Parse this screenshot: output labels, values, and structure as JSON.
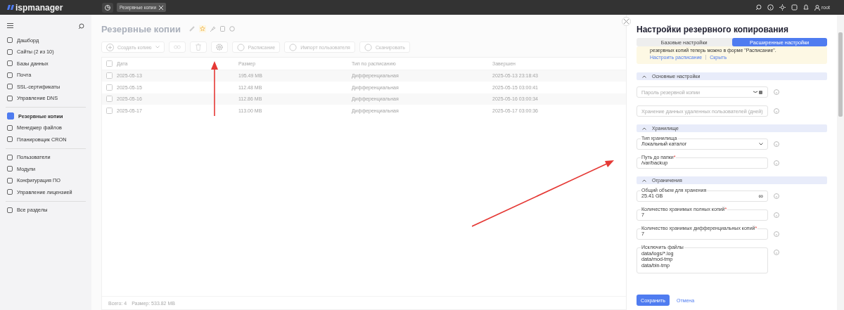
{
  "top_bar": {
    "logo": "ispmanager",
    "tabs": [
      {
        "label": "Резервные копии",
        "selected": true
      }
    ],
    "user": "root"
  },
  "sidebar": {
    "groups": [
      [
        {
          "label": "Дашборд",
          "selected": false
        },
        {
          "label": "Сайты (2 из 10)",
          "selected": false
        },
        {
          "label": "Базы данных",
          "selected": false
        },
        {
          "label": "Почта",
          "selected": false
        },
        {
          "label": "SSL-сертификаты",
          "selected": false
        },
        {
          "label": "Управление DNS",
          "selected": false
        }
      ],
      [
        {
          "label": "Резервные копии",
          "selected": true
        },
        {
          "label": "Менеджер файлов",
          "selected": false
        },
        {
          "label": "Планировщик CRON",
          "selected": false
        }
      ],
      [
        {
          "label": "Пользователи",
          "selected": false
        },
        {
          "label": "Модули",
          "selected": false
        },
        {
          "label": "Конфигурация ПО",
          "selected": false
        },
        {
          "label": "Управление лицензией",
          "selected": false
        }
      ],
      [
        {
          "label": "Все разделы",
          "selected": false
        }
      ]
    ]
  },
  "page": {
    "title": "Резервные копии",
    "toolbar": [
      {
        "kind": "dropdown",
        "label": "Создать копию"
      },
      {
        "kind": "icon"
      },
      {
        "kind": "icon"
      },
      {
        "kind": "icon"
      },
      {
        "kind": "text",
        "label": "Расписание"
      },
      {
        "kind": "text",
        "label": "Импорт пользователя"
      },
      {
        "kind": "text",
        "label": "Сканировать"
      }
    ],
    "table": {
      "all_checked": false,
      "columns": [
        "Дата",
        "Размер",
        "Тип по расписанию",
        "Завершен"
      ],
      "rows": [
        {
          "checked": false,
          "cells": [
            "2025-05-13",
            "195.49 MB",
            "Дифференциальная",
            "2025-05-13 23:18:43"
          ]
        },
        {
          "checked": false,
          "cells": [
            "2025-05-15",
            "112.48 MB",
            "Дифференциальная",
            "2025-05-15 03:00:41"
          ]
        },
        {
          "checked": false,
          "cells": [
            "2025-05-16",
            "112.86 MB",
            "Дифференциальная",
            "2025-05-16 03:00:34"
          ]
        },
        {
          "checked": false,
          "cells": [
            "2025-05-17",
            "113.00 MB",
            "Дифференциальная",
            "2025-05-17 03:00:36"
          ]
        }
      ]
    },
    "footer": {
      "total": "Всего: 4",
      "size": "Размер: 533.82 MB"
    }
  },
  "drawer": {
    "title": "Настройки резервного копирования",
    "tabs": [
      {
        "label": "Базовые настройки",
        "selected": false
      },
      {
        "label": "Расширенные настройки",
        "selected": true
      }
    ],
    "notice": {
      "text": "резервных копий теперь можно в форме \"Расписание\".",
      "links": [
        "Настроить расписание",
        "Скрыть"
      ]
    },
    "sections": [
      {
        "title": "Основные настройки",
        "expanded": true,
        "fields": [
          {
            "kind": "password",
            "placeholder": "Пароль резервной копии"
          },
          {
            "kind": "text",
            "placeholder": "Хранение данных удаленных пользователей (дней)"
          }
        ]
      },
      {
        "title": "Хранилище",
        "expanded": true,
        "fields": [
          {
            "kind": "select",
            "label": "Тип хранилища",
            "value": "Локальный каталог"
          },
          {
            "kind": "text",
            "label": "Путь до папки",
            "required_mark": "*",
            "value": "/var/backup"
          }
        ]
      },
      {
        "title": "Ограничения",
        "expanded": true,
        "fields": [
          {
            "kind": "text",
            "label": "Общий объем для хранения",
            "value": "25.41 GB",
            "suffix": "∞"
          },
          {
            "kind": "text",
            "label": "Количество хранимых полных копий",
            "required_mark": "*",
            "value": "7"
          },
          {
            "kind": "text",
            "label": "Количество хранимых дифференциальных копий",
            "required_mark": "*",
            "value": "7"
          },
          {
            "kind": "textarea",
            "label": "Исключить файлы",
            "value": "data/logs/*.log\ndata/mod-tmp\ndata/bin-tmp"
          }
        ]
      }
    ],
    "buttons": {
      "save": "Сохранить",
      "cancel": "Отмена"
    }
  }
}
